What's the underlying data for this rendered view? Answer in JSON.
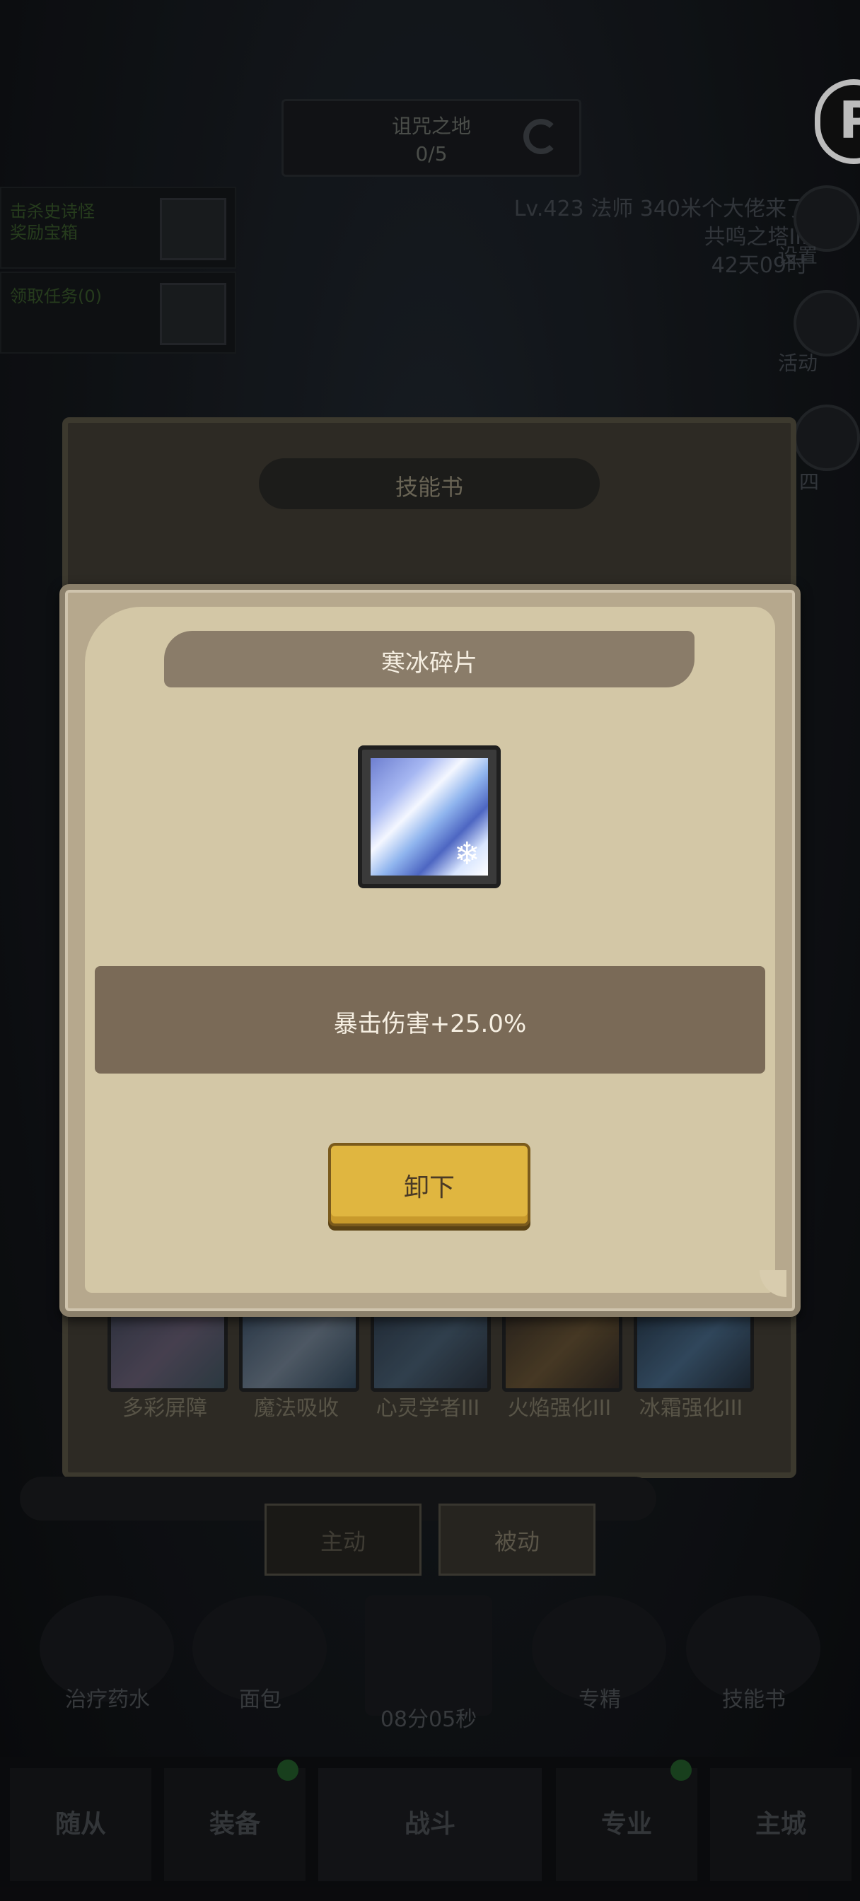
{
  "background": {
    "boss": {
      "title": "诅咒之地",
      "progress": "0/5"
    },
    "left_cards": [
      {
        "text": "击杀史诗怪\n奖励宝箱"
      },
      {
        "text": "领取任务(0)"
      }
    ],
    "player_info": {
      "line1": "Lv.423 法师  340米个大佬来了",
      "line2": "共鸣之塔III",
      "line3": "42天09时"
    },
    "side_buttons": [
      "设置",
      "活动",
      "四"
    ],
    "pill_letter": "P",
    "skill_panel": {
      "title": "技能书",
      "skills": [
        "多彩屏障",
        "魔法吸收",
        "心灵学者III",
        "火焰强化III",
        "冰霜强化III"
      ],
      "tabs": [
        "主动",
        "被动"
      ]
    },
    "bottom_actions": [
      "治疗药水",
      "面包",
      "08分05秒",
      "专精",
      "技能书"
    ],
    "nav": [
      "随从",
      "装备",
      "战斗",
      "专业",
      "主城"
    ]
  },
  "modal": {
    "title": "寒冰碎片",
    "item_icon": "ice-shard-icon",
    "description": "暴击伤害+25.0%",
    "button_label": "卸下"
  }
}
